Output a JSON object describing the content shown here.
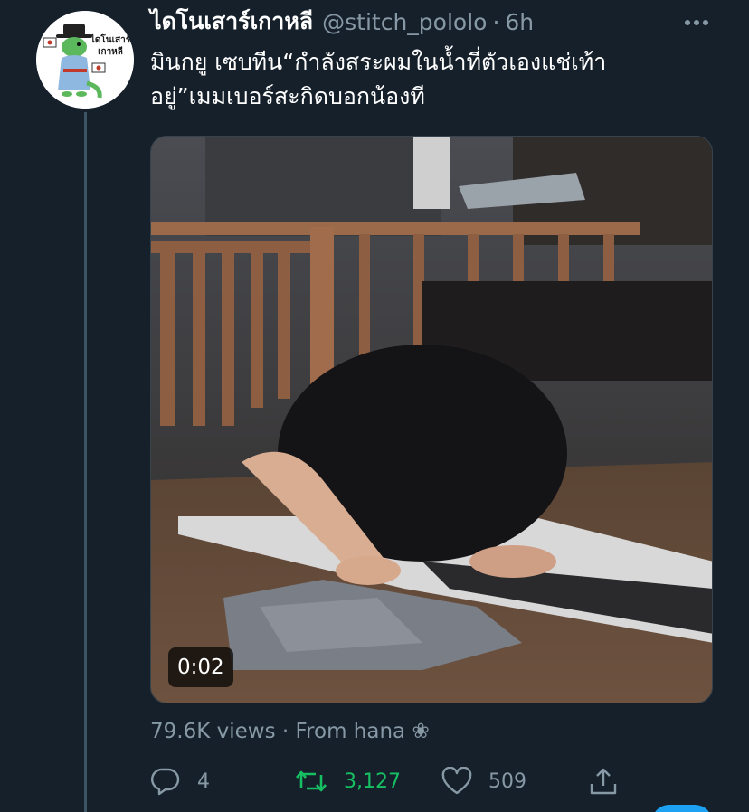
{
  "tweet": {
    "display_name": "ไดโนเสาร์เกาหลี",
    "handle": "@stitch_pololo",
    "separator": "·",
    "time": "6h",
    "avatar_text": "ไดโนเสาร์เกาหลี",
    "text": "มินกยู เซบทีน“กำลังสระผมในน้ำที่ตัวเองแช่เท้าอยู่”เมมเบอร์สะกิดบอกน้องที"
  },
  "media": {
    "type": "video",
    "duration": "0:02"
  },
  "meta": {
    "views": "79.6K views",
    "separator": "·",
    "source": "From hana ❀"
  },
  "actions": {
    "replies": "4",
    "retweets": "3,127",
    "likes": "509"
  },
  "colors": {
    "background": "#15202b",
    "secondary_text": "#8899a6",
    "retweet_green": "#17bf63",
    "accent_blue": "#1da1f2"
  },
  "icons": [
    "more-icon",
    "reply-icon",
    "retweet-icon",
    "like-icon",
    "share-icon"
  ]
}
